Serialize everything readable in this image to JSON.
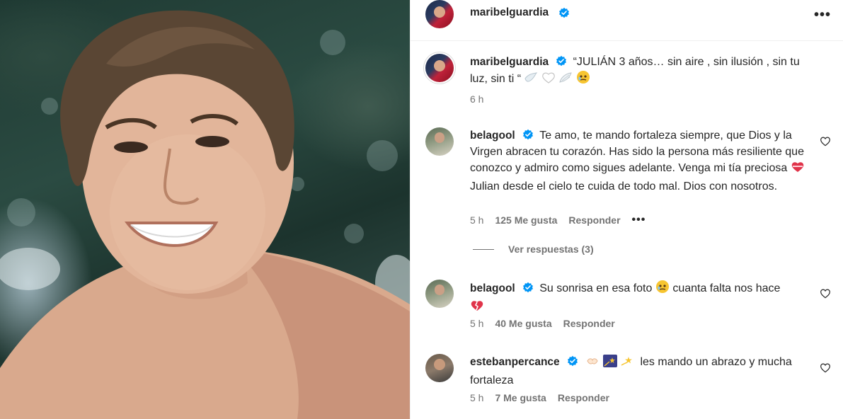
{
  "post": {
    "owner_username": "maribelguardia",
    "more_label": "•••"
  },
  "caption": {
    "username": "maribelguardia",
    "text": "“JULIÁN 3 años… sin aire , sin ilusión , sin tu luz, sin ti “",
    "time": "6 h"
  },
  "comments": [
    {
      "username": "belagool",
      "text_a": "Te amo, te mando fortaleza siempre, que Dios y la Virgen abracen tu corazón. Has sido la persona más resiliente que conozco y admiro como sigues adelante. Venga mi tía preciosa",
      "text_b": "Julian desde el cielo te cuida de todo mal. Dios con nosotros.",
      "time": "5 h",
      "likes": "125 Me gusta",
      "reply": "Responder",
      "options": "•••",
      "view_replies": "Ver respuestas (3)"
    },
    {
      "username": "belagool",
      "text_a": "Su sonrisa en esa foto",
      "text_b": "cuanta falta nos hace",
      "time": "5 h",
      "likes": "40 Me gusta",
      "reply": "Responder"
    },
    {
      "username": "estebanpercance",
      "text": "les mando un abrazo y mucha fortaleza",
      "time": "5 h",
      "likes": "7 Me gusta",
      "reply": "Responder"
    }
  ],
  "colors": {
    "verified": "#0095f6",
    "secondary_text": "#737373",
    "primary_text": "#262626"
  },
  "icons": [
    "verified-badge-icon",
    "heart-outline-icon",
    "more-options-icon"
  ]
}
